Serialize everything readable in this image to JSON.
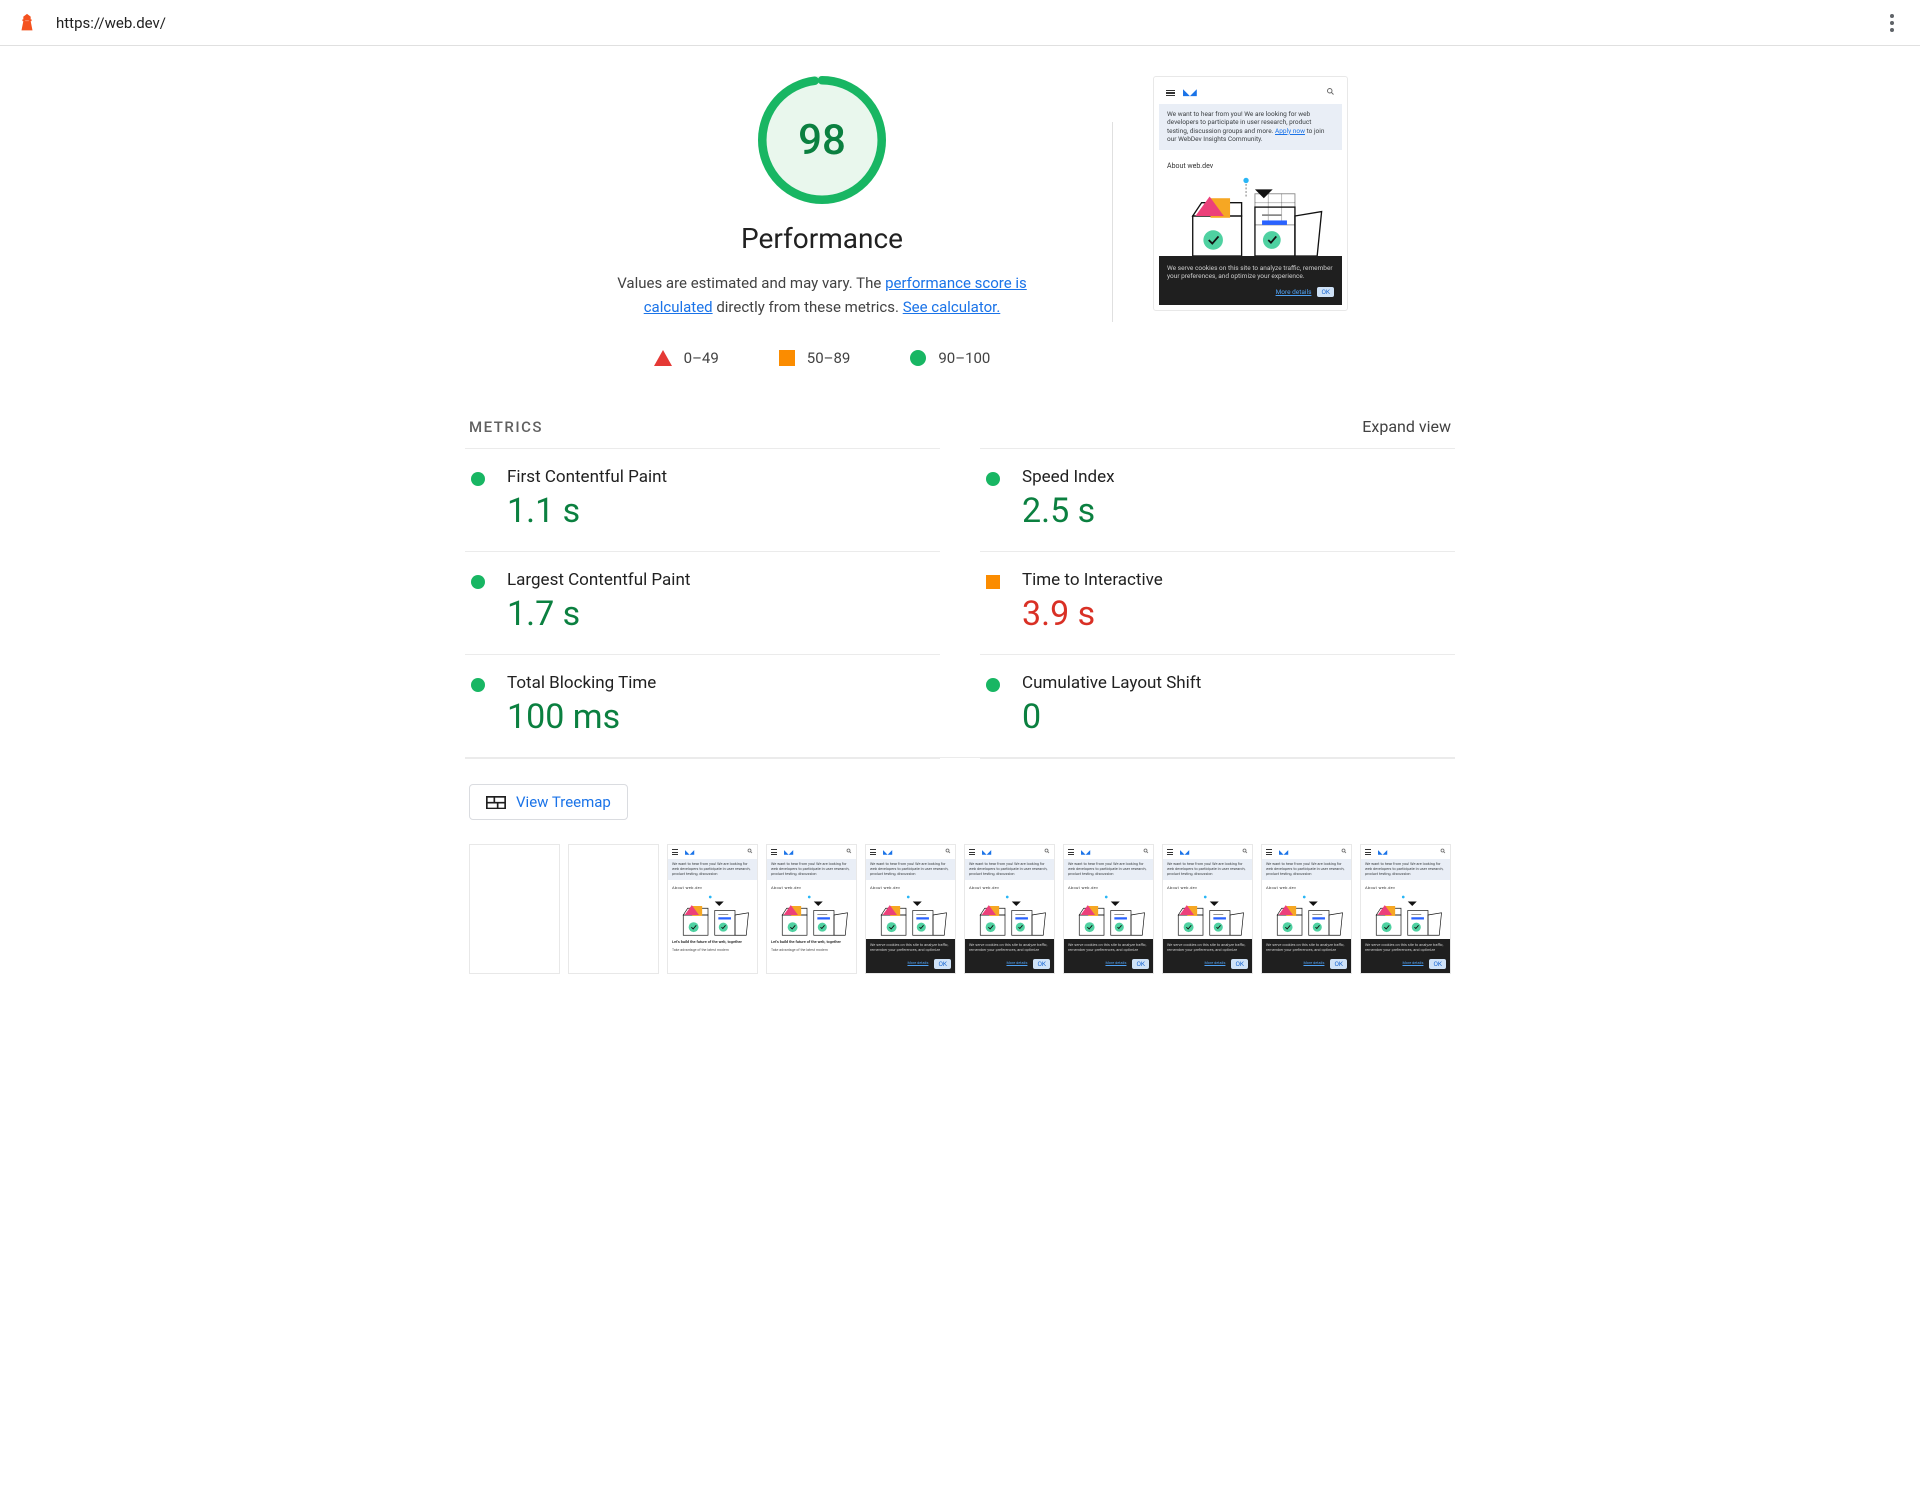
{
  "topbar": {
    "url": "https://web.dev/"
  },
  "gauge": {
    "score": "98",
    "category": "Performance"
  },
  "description": {
    "pre": "Values are estimated and may vary. The ",
    "link1": "performance score is calculated",
    "mid": " directly from these metrics. ",
    "link2": "See calculator."
  },
  "legend": {
    "fail": "0–49",
    "average": "50–89",
    "pass": "90–100"
  },
  "metrics_header": {
    "label": "METRICS",
    "expand": "Expand view"
  },
  "metrics": [
    {
      "name": "First Contentful Paint",
      "value": "1.1 s",
      "status": "green"
    },
    {
      "name": "Speed Index",
      "value": "2.5 s",
      "status": "green"
    },
    {
      "name": "Largest Contentful Paint",
      "value": "1.7 s",
      "status": "green"
    },
    {
      "name": "Time to Interactive",
      "value": "3.9 s",
      "status": "orange"
    },
    {
      "name": "Total Blocking Time",
      "value": "100 ms",
      "status": "green"
    },
    {
      "name": "Cumulative Layout Shift",
      "value": "0",
      "status": "green"
    }
  ],
  "treemap_button": "View Treemap",
  "preview": {
    "banner": "We want to hear from you! We are looking for web developers to participate in user research, product testing, discussion groups and more. ",
    "banner_link": "Apply now",
    "banner_tail": " to join our WebDev Insights Community.",
    "about": "About web.dev",
    "cookie": "We serve cookies on this site to analyze traffic, remember your preferences, and optimize your experience.",
    "more": "More details",
    "ok": "OK"
  },
  "thumb_captions": {
    "headline": "Let's build the future of the web, together",
    "sub": "Take advantage of the latest modern"
  },
  "filmstrip_variants": [
    "blank",
    "blank",
    "caption",
    "caption",
    "cookie",
    "cookie",
    "cookie",
    "cookie",
    "cookie",
    "cookie"
  ]
}
